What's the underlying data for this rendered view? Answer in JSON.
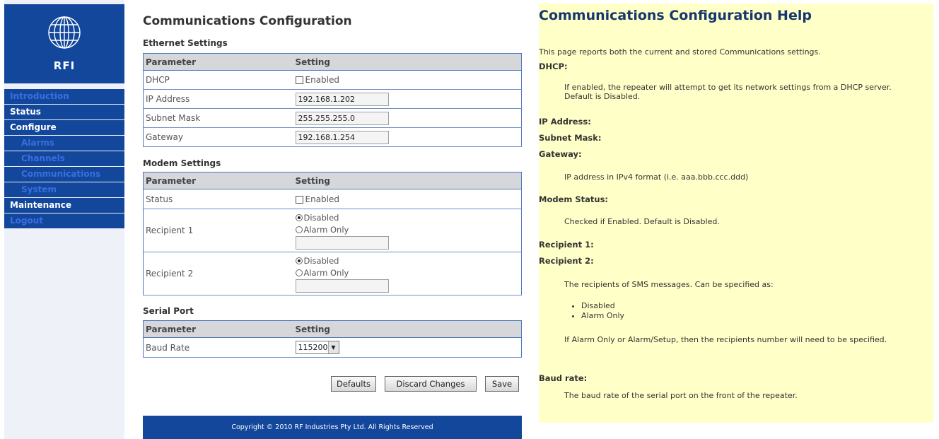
{
  "sidebar": {
    "logo_text": "RFI",
    "nav": [
      {
        "label": "Introduction",
        "color": "blue",
        "sub": false
      },
      {
        "label": "Status",
        "color": "white",
        "sub": false
      },
      {
        "label": "Configure",
        "color": "white",
        "sub": false
      },
      {
        "label": "Alarms",
        "color": "blue",
        "sub": true
      },
      {
        "label": "Channels",
        "color": "blue",
        "sub": true
      },
      {
        "label": "Communications",
        "color": "blue",
        "sub": true
      },
      {
        "label": "System",
        "color": "blue",
        "sub": true
      },
      {
        "label": "Maintenance",
        "color": "white",
        "sub": false
      },
      {
        "label": "Logout",
        "color": "blue",
        "sub": false
      }
    ]
  },
  "main": {
    "title": "Communications Configuration",
    "ethernet": {
      "section": "Ethernet Settings",
      "col_param": "Parameter",
      "col_setting": "Setting",
      "dhcp_label": "DHCP",
      "dhcp_enabled_label": "Enabled",
      "ip_label": "IP Address",
      "ip_value": "192.168.1.202",
      "subnet_label": "Subnet Mask",
      "subnet_value": "255.255.255.0",
      "gateway_label": "Gateway",
      "gateway_value": "192.168.1.254"
    },
    "modem": {
      "section": "Modem Settings",
      "col_param": "Parameter",
      "col_setting": "Setting",
      "status_label": "Status",
      "status_enabled_label": "Enabled",
      "r1_label": "Recipient 1",
      "r2_label": "Recipient 2",
      "opt_disabled": "Disabled",
      "opt_alarm": "Alarm Only"
    },
    "serial": {
      "section": "Serial Port",
      "col_param": "Parameter",
      "col_setting": "Setting",
      "baud_label": "Baud Rate",
      "baud_value": "115200"
    },
    "buttons": {
      "defaults": "Defaults",
      "discard": "Discard Changes",
      "save": "Save"
    },
    "footer": "Copyright © 2010 RF Industries Pty Ltd. All Rights Reserved"
  },
  "help": {
    "title": "Communications Configuration Help",
    "intro": "This page reports both the current and stored Communications settings.",
    "dhcp_term": "DHCP:",
    "dhcp_desc": "If enabled, the repeater will attempt to get its network settings from a DHCP server. Default is Disabled.",
    "ip_term": "IP Address:",
    "subnet_term": "Subnet Mask:",
    "gateway_term": "Gateway:",
    "ip_desc": "IP address in IPv4 format (i.e. aaa.bbb.ccc.ddd)",
    "modem_term": "Modem Status:",
    "modem_desc": "Checked if Enabled. Default is Disabled.",
    "r1_term": "Recipient 1:",
    "r2_term": "Recipient 2:",
    "recip_desc": "The recipients of SMS messages. Can be specified as:",
    "recip_opts": [
      "Disabled",
      "Alarm Only"
    ],
    "recip_note": "If Alarm Only or Alarm/Setup, then the recipients number will need to be specified.",
    "baud_term": "Baud rate:",
    "baud_desc": "The baud rate of the serial port on the front of the repeater."
  }
}
